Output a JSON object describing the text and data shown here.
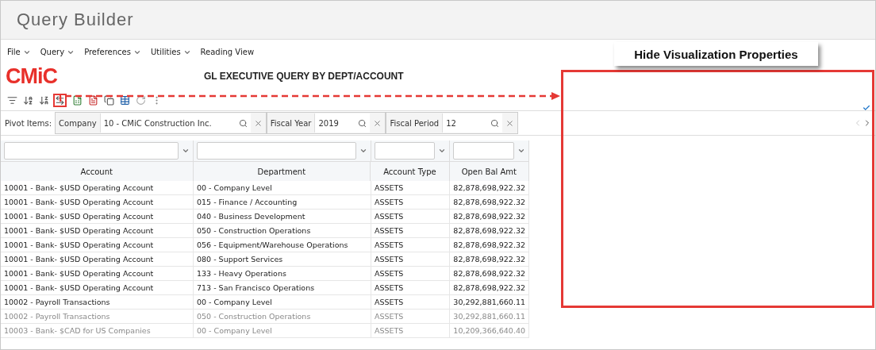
{
  "app_title": "Query Builder",
  "menu": [
    {
      "label": "File",
      "dropdown": true
    },
    {
      "label": "Query",
      "dropdown": true
    },
    {
      "label": "Preferences",
      "dropdown": true
    },
    {
      "label": "Utilities",
      "dropdown": true
    },
    {
      "label": "Reading View",
      "dropdown": false
    }
  ],
  "logo": "CMiC",
  "report_title": "GL EXECUTIVE QUERY BY DEPT/ACCOUNT",
  "toolbar": [
    {
      "kind": "filter",
      "highlighted": false
    },
    {
      "kind": "sort-asc",
      "highlighted": false
    },
    {
      "kind": "sort-desc",
      "highlighted": false
    },
    {
      "kind": "columns",
      "highlighted": true
    },
    {
      "kind": "excel",
      "highlighted": false
    },
    {
      "kind": "pdf",
      "highlighted": false
    },
    {
      "kind": "copy",
      "highlighted": false
    },
    {
      "kind": "table",
      "highlighted": false
    },
    {
      "kind": "refresh",
      "highlighted": false
    },
    {
      "kind": "more",
      "highlighted": false
    }
  ],
  "pivot": {
    "label": "Pivot Items:",
    "items": [
      {
        "label": "Company",
        "value": "10 - CMiC Construction Inc."
      },
      {
        "label": "Fiscal Year",
        "value": "2019"
      },
      {
        "label": "Fiscal Period",
        "value": "12"
      }
    ]
  },
  "table": {
    "columns": [
      {
        "label": "Account"
      },
      {
        "label": "Department"
      },
      {
        "label": "Account Type"
      },
      {
        "label": "Open Bal Amt"
      }
    ],
    "rows": [
      [
        "10001 - Bank- $USD Operating Account",
        "00 - Company Level",
        "ASSETS",
        "82,878,698,922.32"
      ],
      [
        "10001 - Bank- $USD Operating Account",
        "015 - Finance / Accounting",
        "ASSETS",
        "82,878,698,922.32"
      ],
      [
        "10001 - Bank- $USD Operating Account",
        "040 - Business Development",
        "ASSETS",
        "82,878,698,922.32"
      ],
      [
        "10001 - Bank- $USD Operating Account",
        "050 - Construction Operations",
        "ASSETS",
        "82,878,698,922.32"
      ],
      [
        "10001 - Bank- $USD Operating Account",
        "056 - Equipment/Warehouse Operations",
        "ASSETS",
        "82,878,698,922.32"
      ],
      [
        "10001 - Bank- $USD Operating Account",
        "080 - Support Services",
        "ASSETS",
        "82,878,698,922.32"
      ],
      [
        "10001 - Bank- $USD Operating Account",
        "133 - Heavy Operations",
        "ASSETS",
        "82,878,698,922.32"
      ],
      [
        "10001 - Bank- $USD Operating Account",
        "713 - San Francisco Operations",
        "ASSETS",
        "82,878,698,922.32"
      ],
      [
        "10002 - Payroll Transactions",
        "00 - Company Level",
        "ASSETS",
        "30,292,881,660.11"
      ],
      [
        "10002 - Payroll Transactions",
        "050 - Construction Operations",
        "ASSETS",
        "30,292,881,660.11"
      ],
      [
        "10003 - Bank- $CAD for US Companies",
        "00 - Company Level",
        "ASSETS",
        "10,209,366,640.40"
      ]
    ]
  },
  "callout": "Hide Visualization Properties"
}
